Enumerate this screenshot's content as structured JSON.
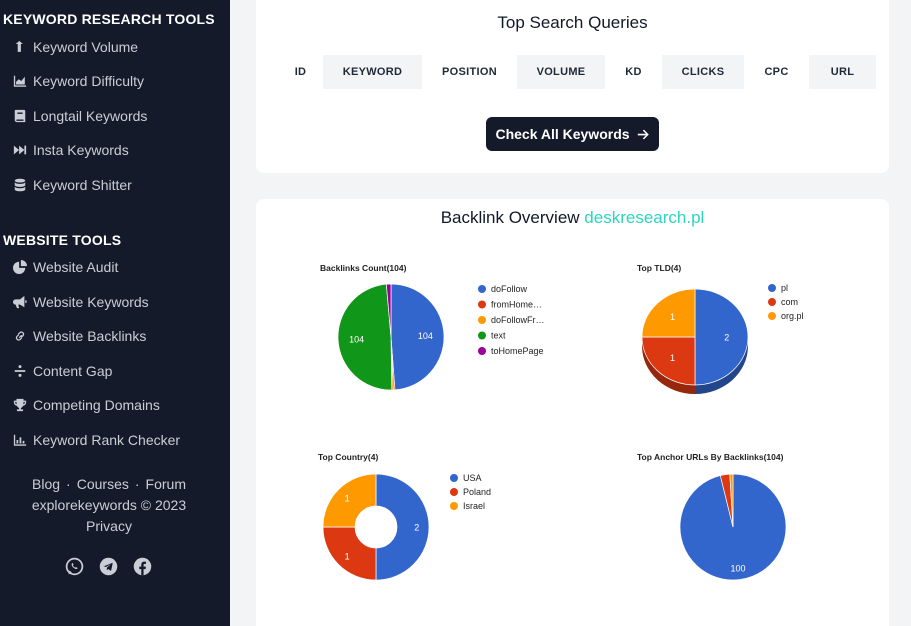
{
  "sidebar": {
    "keyword_section": "KEYWORD RESEARCH TOOLS",
    "keyword_items": [
      {
        "label": "Keyword Volume",
        "icon": "arrow-up-icon"
      },
      {
        "label": "Keyword Difficulty",
        "icon": "area-chart-icon"
      },
      {
        "label": "Longtail Keywords",
        "icon": "book-icon"
      },
      {
        "label": "Insta Keywords",
        "icon": "fast-forward-icon"
      },
      {
        "label": "Keyword Shitter",
        "icon": "database-icon"
      }
    ],
    "website_section": "WEBSITE TOOLS",
    "website_items": [
      {
        "label": "Website Audit",
        "icon": "pie-chart-icon"
      },
      {
        "label": "Website Keywords",
        "icon": "bullhorn-icon"
      },
      {
        "label": "Website Backlinks",
        "icon": "link-icon"
      },
      {
        "label": "Content Gap",
        "icon": "divide-icon"
      },
      {
        "label": "Competing Domains",
        "icon": "trophy-icon"
      },
      {
        "label": "Keyword Rank Checker",
        "icon": "bar-chart-icon"
      }
    ],
    "footer": {
      "blog": "Blog",
      "courses": "Courses",
      "forum": "Forum",
      "separator": "·",
      "copyright": "explorekeywords © 2023",
      "privacy": "Privacy"
    },
    "social_icons": [
      "whatsapp-icon",
      "telegram-icon",
      "facebook-icon"
    ]
  },
  "queries": {
    "title": "Top Search Queries",
    "columns": [
      "ID",
      "KEYWORD",
      "POSITION",
      "VOLUME",
      "KD",
      "CLICKS",
      "CPC",
      "URL"
    ],
    "button": "Check All Keywords"
  },
  "backlinks": {
    "title": "Backlink Overview",
    "domain": "deskresearch.pl"
  },
  "colors": {
    "blue": "#3366cc",
    "red": "#dc3912",
    "orange": "#ff9900",
    "green": "#109618",
    "purple": "#990099",
    "teal": "#2dd4bf",
    "sidebar": "#141a29"
  },
  "chart_data": [
    {
      "type": "pie",
      "title": "Backlinks Count(104)",
      "style": "3d",
      "legend": "right",
      "categories": [
        "doFollow",
        "fromHome…",
        "doFollowFr…",
        "text",
        "toHomePage"
      ],
      "values": [
        104,
        1,
        1,
        104,
        3
      ],
      "data_labels": [
        "104",
        "",
        "",
        "104",
        ""
      ]
    },
    {
      "type": "pie",
      "title": "Top TLD(4)",
      "style": "3d",
      "legend": "right",
      "categories": [
        "pl",
        "com",
        "org.pl"
      ],
      "values": [
        2,
        1,
        1
      ],
      "data_labels": [
        "2",
        "1",
        "1"
      ]
    },
    {
      "type": "pie",
      "title": "Top Country(4)",
      "style": "donut",
      "legend": "right",
      "categories": [
        "USA",
        "Poland",
        "Israel"
      ],
      "values": [
        2,
        1,
        1
      ],
      "data_labels": [
        "2",
        "1",
        "1"
      ]
    },
    {
      "type": "pie",
      "title": "Top Anchor URLs By Backlinks(104)",
      "style": "flat",
      "legend": "none",
      "categories": [
        "",
        "",
        ""
      ],
      "values": [
        100,
        3,
        1
      ],
      "data_labels": [
        "100",
        "",
        ""
      ]
    }
  ]
}
